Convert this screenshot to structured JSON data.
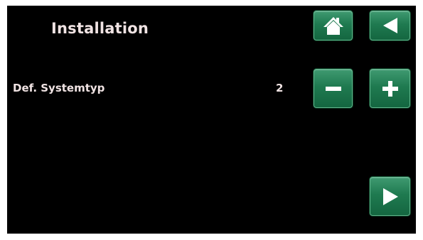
{
  "header": {
    "title": "Installation"
  },
  "setting": {
    "label": "Def. Systemtyp",
    "value": "2"
  },
  "icons": {
    "home": "home-icon",
    "back": "back-arrow-icon",
    "minus": "minus-icon",
    "plus": "plus-icon",
    "next": "forward-arrow-icon"
  },
  "colors": {
    "background": "#000000",
    "text": "#f0e3e3",
    "button": "#1f7a50",
    "icon": "#ffffff"
  }
}
